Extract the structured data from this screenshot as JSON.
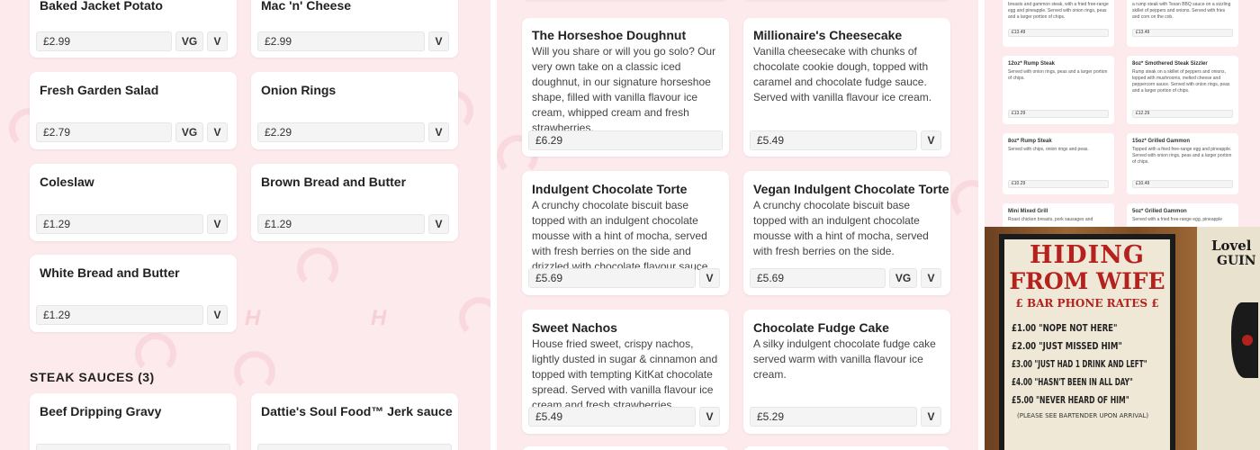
{
  "left_panel": {
    "cards": [
      {
        "title": "Baked Jacket Potato",
        "price": "£2.99",
        "tags": [
          "VG",
          "V"
        ]
      },
      {
        "title": "Mac 'n' Cheese",
        "price": "£2.99",
        "tags": [
          "V"
        ]
      },
      {
        "title": "Fresh Garden Salad",
        "price": "£2.79",
        "tags": [
          "VG",
          "V"
        ]
      },
      {
        "title": "Onion Rings",
        "price": "£2.29",
        "tags": [
          "V"
        ]
      },
      {
        "title": "Coleslaw",
        "price": "£1.29",
        "tags": [
          "V"
        ]
      },
      {
        "title": "Brown Bread and Butter",
        "price": "£1.29",
        "tags": [
          "V"
        ]
      },
      {
        "title": "White Bread and Butter",
        "price": "£1.29",
        "tags": [
          "V"
        ]
      }
    ],
    "section_heading": "STEAK SAUCES (3)",
    "sauce_cards": [
      {
        "title": "Beef Dripping Gravy"
      },
      {
        "title": "Dattie's Soul Food™ Jerk sauce"
      }
    ]
  },
  "middle_panel": {
    "cards": [
      {
        "title": "The Horseshoe Doughnut",
        "desc": "Will you share or will you go solo? Our very own take on a classic iced doughnut, in our signature horseshoe shape, filled with vanilla flavour ice cream, whipped cream and fresh strawberries.",
        "price": "£6.29",
        "tags": []
      },
      {
        "title": "Millionaire's Cheesecake",
        "desc": "Vanilla cheesecake with chunks of chocolate cookie dough, topped with caramel and chocolate fudge sauce. Served with vanilla flavour ice cream.",
        "price": "£5.49",
        "tags": [
          "V"
        ]
      },
      {
        "title": "Indulgent Chocolate Torte",
        "desc": "A crunchy chocolate biscuit base topped with an indulgent chocolate mousse with a hint of mocha, served with fresh berries on the side and drizzled with chocolate flavour sauce.",
        "price": "£5.69",
        "tags": [
          "V"
        ]
      },
      {
        "title": "Vegan Indulgent Chocolate Torte",
        "desc": "A crunchy chocolate biscuit base topped with an indulgent chocolate mousse with a hint of mocha, served with fresh berries on the side.",
        "price": "£5.69",
        "tags": [
          "VG",
          "V"
        ]
      },
      {
        "title": "Sweet Nachos",
        "desc": "House fried sweet, crispy nachos, lightly dusted in sugar & cinnamon and topped with tempting KitKat chocolate spread. Served with vanilla flavour ice cream and fresh strawberries.",
        "price": "£5.49",
        "tags": [
          "V"
        ]
      },
      {
        "title": "Chocolate Fudge Cake",
        "desc": "A silky indulgent chocolate fudge cake served warm with vanilla flavour ice cream.",
        "price": "£5.29",
        "tags": [
          "V"
        ]
      }
    ]
  },
  "right_thumb": {
    "cards": [
      {
        "title": "",
        "desc": "breasts and gammon steak, with a fried free-range egg and pineapple. Served with onion rings, peas and a larger portion of chips.",
        "price": "£13.49"
      },
      {
        "title": "",
        "desc": "a rump steak with Texan BBQ sauce on a sizzling skillet of peppers and onions. Served with fries and corn on the cob.",
        "price": "£13.49"
      },
      {
        "title": "12oz* Rump Steak",
        "desc": "Served with onion rings, peas and a larger portion of chips.",
        "price": "£13.29"
      },
      {
        "title": "8oz* Smothered Steak Sizzler",
        "desc": "Rump steak on a skillet of peppers and onions, topped with mushrooms, melted cheese and peppercorn sauce. Served with onion rings, peas and a larger portion of chips.",
        "price": "£12.29"
      },
      {
        "title": "8oz* Rump Steak",
        "desc": "Served with chips, onion rings and peas.",
        "price": "£10.29"
      },
      {
        "title": "15oz* Grilled Gammon",
        "desc": "Topped with a fried free-range egg and pineapple. Served with onion rings, peas and a larger portion of chips.",
        "price": "£10.49"
      },
      {
        "title": "Mini Mixed Grill",
        "desc": "Roast chicken breasts, pork sausages and",
        "price": ""
      },
      {
        "title": "5oz* Grilled Gammon",
        "desc": "Served with a fried free-range egg, pineapple",
        "price": ""
      }
    ]
  },
  "photo": {
    "sign_lines": [
      "HIDING",
      "FROM WIFE",
      "£ BAR PHONE RATES £",
      "£1.00 \"NOPE NOT HERE\"",
      "£2.00 \"JUST MISSED HIM\"",
      "£3.00 \"JUST HAD 1 DRINK AND LEFT\"",
      "£4.00 \"HASN'T BEEN IN ALL DAY\"",
      "£5.00 \"NEVER HEARD OF HIM\"",
      "(PLEASE SEE BARTENDER UPON ARRIVAL)"
    ],
    "poster_text": [
      "Lovel",
      "GUIN"
    ]
  },
  "colors": {
    "pink_bg": "#fceaec",
    "horseshoe": "#f9d2d8",
    "sign_red": "#b5211d",
    "wood": "#8a5a2e"
  }
}
